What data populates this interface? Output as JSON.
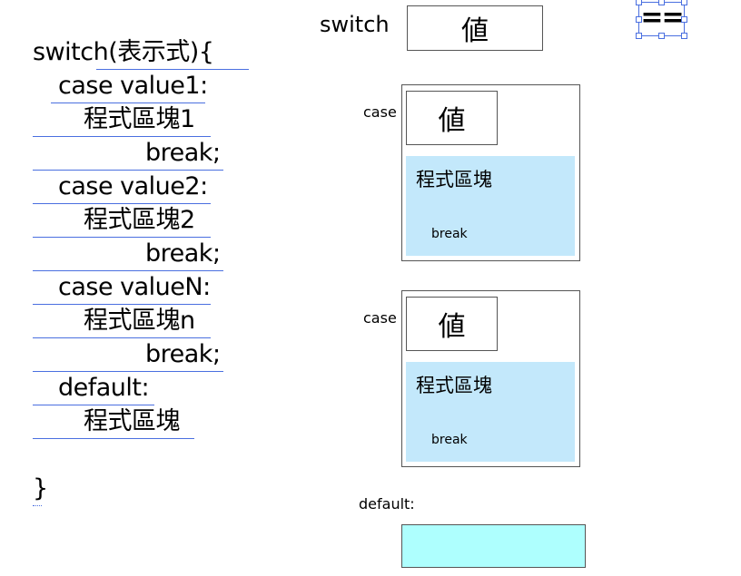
{
  "code": {
    "lines": [
      "switch(表示式){",
      "case value1:",
      "程式區塊1",
      "break;",
      "case value2:",
      "程式區塊2",
      "break;",
      "case valueN:",
      "程式區塊n",
      "break;",
      "default:",
      "程式區塊",
      "}"
    ]
  },
  "diagram": {
    "switch_label": "switch",
    "switch_value": "値",
    "operator": "==",
    "cases": [
      {
        "label": "case",
        "value": "値",
        "block_title": "程式區塊",
        "break_text": "break"
      },
      {
        "label": "case",
        "value": "値",
        "block_title": "程式區塊",
        "break_text": "break"
      }
    ],
    "default_label": "default:"
  },
  "colors": {
    "case_block_fill": "#c3e8fb",
    "default_block_fill": "#aefffe",
    "underline": "#4a6fe0"
  }
}
